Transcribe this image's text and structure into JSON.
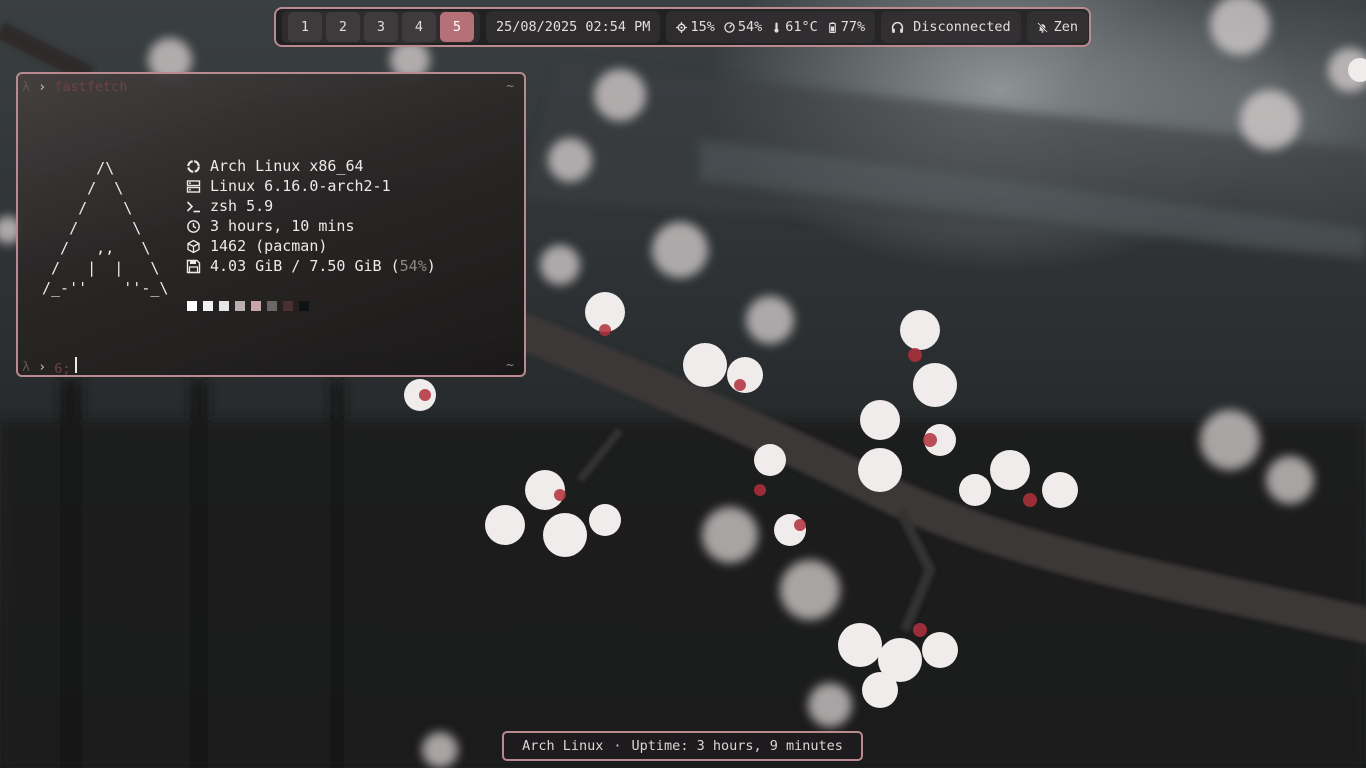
{
  "topbar": {
    "workspaces": [
      "1",
      "2",
      "3",
      "4",
      "5"
    ],
    "active_workspace": "5",
    "datetime": "25/08/2025 02:54 PM",
    "cpu": "15%",
    "memory": "54%",
    "temperature": "61°C",
    "battery": "77%",
    "audio_status": "Disconnected",
    "mode": "Zen"
  },
  "terminal": {
    "prompt_symbol_1": "λ",
    "arrow": "›",
    "command": "fastfetch",
    "tilde": "~",
    "ascii_art": "      /\\\n     /  \\\n    /    \\\n   /      \\\n  /   ,,   \\\n /   |  |   \\\n/_-''    ''-_\\",
    "info": {
      "os": "Arch Linux x86_64",
      "kernel": "Linux 6.16.0-arch2-1",
      "shell": "zsh 5.9",
      "uptime": "3 hours, 10 mins",
      "packages": "1462 (pacman)",
      "memory_used": "4.03 GiB / 7.50 GiB (",
      "memory_pct": "54%",
      "memory_close": ")"
    },
    "swatch_colors": [
      "#ffffff",
      "#f2f2f2",
      "#e6e6e6",
      "#b8b0b0",
      "#c9a4a8",
      "#6d6868",
      "#4a2f33",
      "#0e1416"
    ],
    "prompt2_symbol": "λ",
    "prompt2_input": "6;"
  },
  "bottombar": {
    "distro": "Arch Linux",
    "separator": "·",
    "uptime": "Uptime: 3 hours, 9 minutes"
  },
  "colors": {
    "accent": "#b98a8f",
    "active_workspace": "#b57078"
  }
}
